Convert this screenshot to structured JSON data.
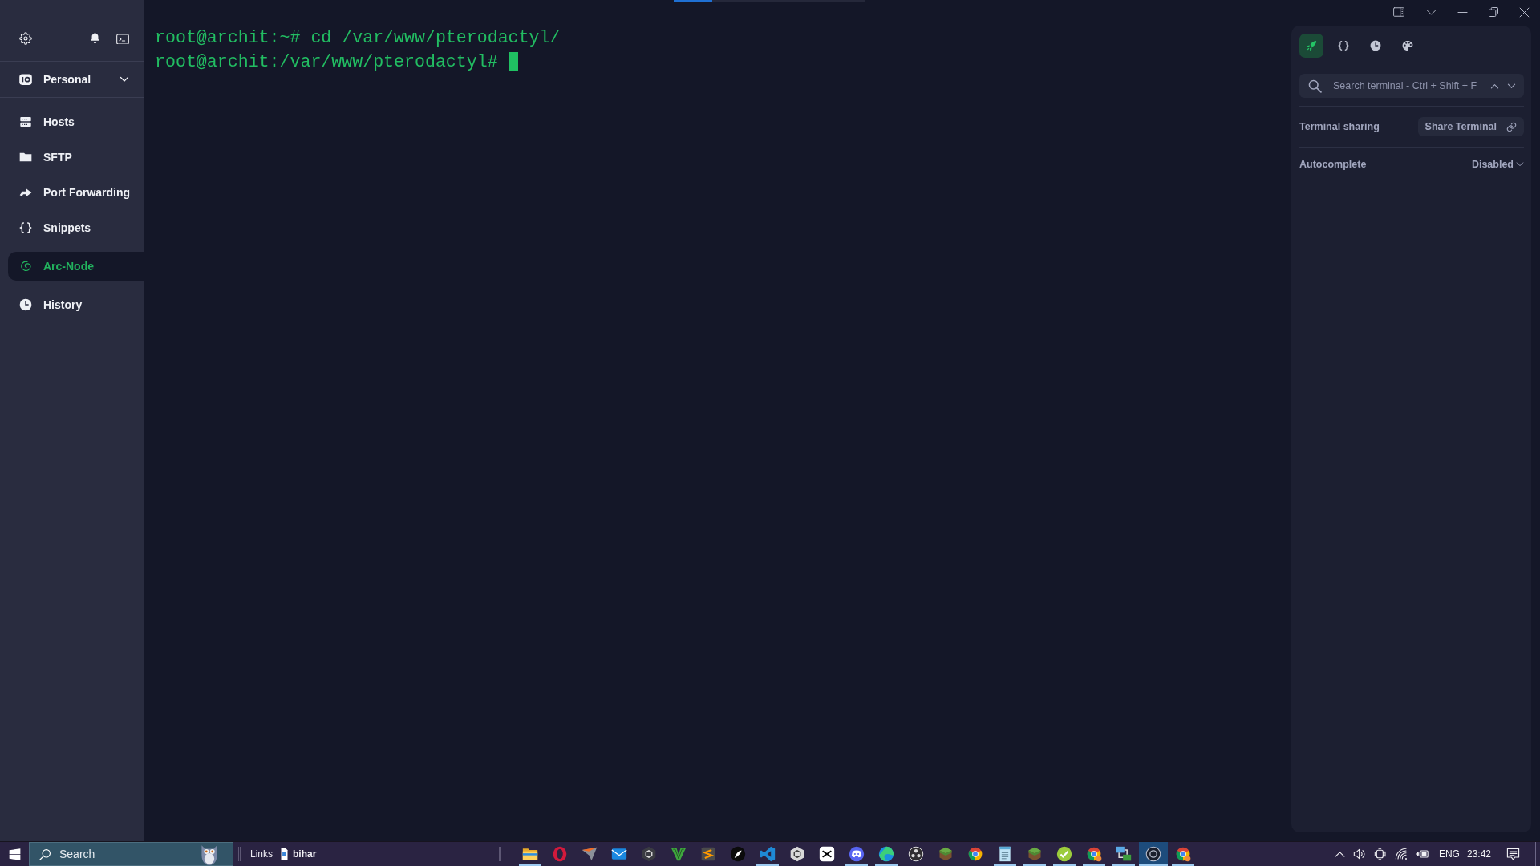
{
  "sidebar": {
    "vault": {
      "label": "Personal"
    },
    "items": [
      {
        "kind": "hosts",
        "label": "Hosts",
        "selected": false
      },
      {
        "kind": "sftp",
        "label": "SFTP",
        "selected": false
      },
      {
        "kind": "forwarding",
        "label": "Port Forwarding",
        "selected": false
      },
      {
        "kind": "snippets",
        "label": "Snippets",
        "selected": false
      },
      {
        "kind": "host",
        "label": "Arc-Node",
        "selected": true
      },
      {
        "kind": "history",
        "label": "History",
        "selected": false
      }
    ]
  },
  "terminal": {
    "lines": [
      "root@archit:~# cd /var/www/pterodactyl/",
      "root@archit:/var/www/pterodactyl#"
    ],
    "cursor": true
  },
  "panel": {
    "tabs": [
      {
        "kind": "rocket",
        "selected": true
      },
      {
        "kind": "braces",
        "selected": false
      },
      {
        "kind": "clock",
        "selected": false
      },
      {
        "kind": "palette",
        "selected": false
      }
    ],
    "search": {
      "placeholder": "Search terminal - Ctrl + Shift + F"
    },
    "sharing": {
      "label": "Terminal sharing",
      "button": "Share Terminal"
    },
    "autocomplete": {
      "label": "Autocomplete",
      "value": "Disabled"
    }
  },
  "taskbar": {
    "search": {
      "placeholder": "Search"
    },
    "toolbar": {
      "label": "Links",
      "items": [
        {
          "label": "bihar"
        }
      ]
    },
    "apps": [
      {
        "kind": "folder",
        "running": true,
        "selected": false
      },
      {
        "kind": "ring",
        "running": false,
        "selected": false
      },
      {
        "kind": "arrowhead",
        "running": false,
        "selected": false
      },
      {
        "kind": "envelope",
        "running": false,
        "selected": false
      },
      {
        "kind": "hexagon",
        "running": false,
        "selected": false
      },
      {
        "kind": "vmark",
        "running": false,
        "selected": false
      },
      {
        "kind": "stripes",
        "running": false,
        "selected": false
      },
      {
        "kind": "feather",
        "running": false,
        "selected": false
      },
      {
        "kind": "ribbon",
        "running": true,
        "selected": false
      },
      {
        "kind": "cube",
        "running": false,
        "selected": false
      },
      {
        "kind": "bowtie",
        "running": false,
        "selected": false
      },
      {
        "kind": "controller",
        "running": true,
        "selected": false
      },
      {
        "kind": "swirl",
        "running": true,
        "selected": false
      },
      {
        "kind": "dots",
        "running": false,
        "selected": false
      },
      {
        "kind": "block",
        "running": false,
        "selected": false
      },
      {
        "kind": "segments",
        "running": false,
        "selected": false
      },
      {
        "kind": "notepad",
        "running": true,
        "selected": false
      },
      {
        "kind": "block",
        "running": true,
        "selected": false
      },
      {
        "kind": "check",
        "running": true,
        "selected": false
      },
      {
        "kind": "segments-badge",
        "running": true,
        "selected": false
      },
      {
        "kind": "network",
        "running": true,
        "selected": false
      },
      {
        "kind": "lens",
        "running": true,
        "selected": true
      },
      {
        "kind": "segments-badge",
        "running": true,
        "selected": false
      }
    ],
    "tray": {
      "language": "ENG",
      "time": "23:42"
    }
  }
}
